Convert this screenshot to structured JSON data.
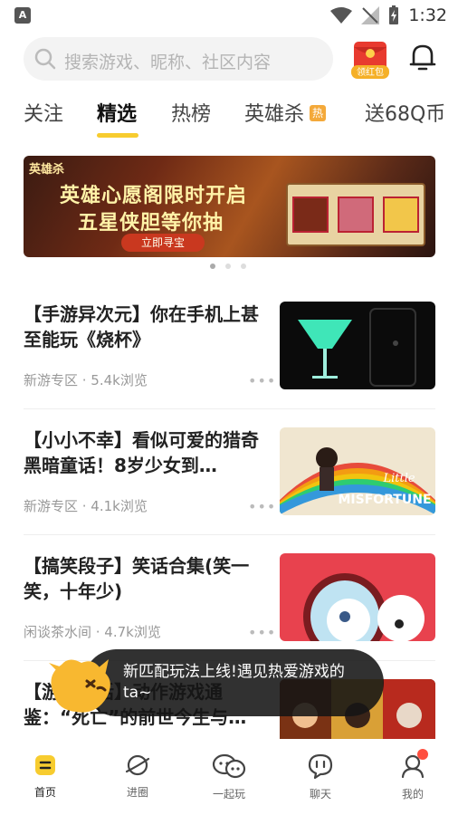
{
  "status_bar": {
    "time": "1:32",
    "app_icon_letter": "A"
  },
  "search": {
    "placeholder": "搜索游戏、昵称、社区内容"
  },
  "red_packet": {
    "label": "领红包"
  },
  "tabs": [
    {
      "label": "关注"
    },
    {
      "label": "精选"
    },
    {
      "label": "热榜"
    },
    {
      "label": "英雄杀",
      "badge": "热"
    },
    {
      "label": "送68Q币"
    }
  ],
  "banner": {
    "logo_text": "英雄杀",
    "line1": "英雄心愿阁限时开启",
    "line2": "五星侠胆等你抽",
    "cta": "立即寻宝"
  },
  "feed": [
    {
      "title": "【手游异次元】你在手机上甚至能玩《烧杯》",
      "meta": "新游专区 · 5.4k浏览",
      "more": "•••"
    },
    {
      "title": "【小小不幸】看似可爱的猎奇黑暗童话！8岁少女到…",
      "meta": "新游专区 · 4.1k浏览",
      "more": "•••"
    },
    {
      "title": "【搞笑段子】笑话合集(笑一笑，十年少)",
      "meta": "闲谈茶水间 · 4.7k浏览",
      "more": "•••"
    },
    {
      "title": "【游戏史话】动作游戏通鉴：“死亡”的前世今生与…",
      "meta": "",
      "more": ""
    }
  ],
  "thumb_texts": {
    "misfortune_line1": "Little",
    "misfortune_line2": "MISFORTUNE"
  },
  "toast": {
    "message": "新匹配玩法上线!遇见热爱游戏的ta~"
  },
  "bottom_nav": [
    {
      "label": "首页"
    },
    {
      "label": "进圈"
    },
    {
      "label": "一起玩"
    },
    {
      "label": "聊天"
    },
    {
      "label": "我的"
    }
  ],
  "colors": {
    "accent": "#f7cc2f",
    "hot_badge": "#f4a93a",
    "notify_dot": "#ff4f3f"
  }
}
